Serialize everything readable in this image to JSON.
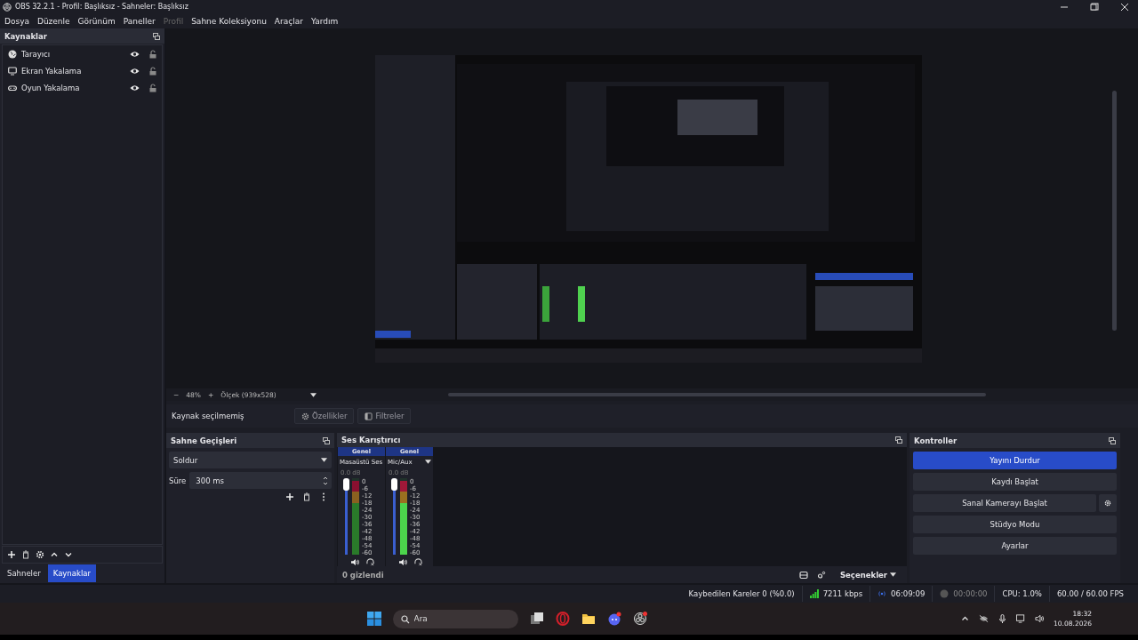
{
  "window": {
    "title": "OBS 32.2.1 - Profil: Başlıksız - Sahneler: Başlıksız"
  },
  "menu": [
    {
      "label": "Dosya",
      "disabled": false
    },
    {
      "label": "Düzenle",
      "disabled": false
    },
    {
      "label": "Görünüm",
      "disabled": false
    },
    {
      "label": "Paneller",
      "disabled": false
    },
    {
      "label": "Profil",
      "disabled": true
    },
    {
      "label": "Sahne Koleksiyonu",
      "disabled": false
    },
    {
      "label": "Araçlar",
      "disabled": false
    },
    {
      "label": "Yardım",
      "disabled": false
    }
  ],
  "sources": {
    "title": "Kaynaklar",
    "items": [
      {
        "name": "Tarayıcı",
        "kind": "browser"
      },
      {
        "name": "Ekran Yakalama",
        "kind": "display"
      },
      {
        "name": "Oyun Yakalama",
        "kind": "game"
      }
    ]
  },
  "dock_tabs": [
    {
      "label": "Sahneler",
      "selected": false
    },
    {
      "label": "Kaynaklar",
      "selected": true
    }
  ],
  "preview": {
    "kind": "picture",
    "zoom_out": "−",
    "zoom": "48%",
    "zoom_in": "+",
    "scale": "Ölçek (939x528)"
  },
  "source_bar": {
    "label": "Kaynak seçilmemiş",
    "buttons": [
      "Özellikler",
      "Filtreler"
    ]
  },
  "transitions": {
    "title": "Sahne Geçişleri",
    "transition": "Soldur",
    "duration_label": "Süre",
    "duration": "300 ms"
  },
  "mixer": {
    "title": "Ses Karıştırıcı",
    "channels": [
      {
        "tag": "Genel",
        "name": "Masaüstü Ses",
        "db": "0.0 dB",
        "fader": {
          "level": 1
        },
        "meter": {
          "level": 0.97
        },
        "active": false,
        "scale": [
          "0",
          "-6",
          "-12",
          "-18",
          "-24",
          "-30",
          "-36",
          "-42",
          "-48",
          "-54",
          "-60"
        ]
      },
      {
        "tag": "Genel",
        "name": "Mic/Aux",
        "db": "0.0 dB",
        "fader": {
          "level": 1
        },
        "meter": {
          "level": 0.97
        },
        "active": true,
        "scale": [
          "0",
          "-6",
          "-12",
          "-18",
          "-24",
          "-30",
          "-36",
          "-42",
          "-48",
          "-54",
          "-60"
        ]
      }
    ],
    "hidden": "0 gizlendi",
    "options": "Seçenekler"
  },
  "controls": {
    "title": "Kontroller",
    "buttons": [
      {
        "label": "Yayını Durdur",
        "active": true,
        "settings": false
      },
      {
        "label": "Kaydı Başlat",
        "active": false,
        "settings": false
      },
      {
        "label": "Sanal Kamerayı Başlat",
        "active": false,
        "settings": true
      },
      {
        "label": "Stüdyo Modu",
        "active": false,
        "settings": false
      },
      {
        "label": "Ayarlar",
        "active": false,
        "settings": false
      }
    ]
  },
  "status_bar": {
    "dropped": "Kaybedilen Kareler 0 (%0.0)",
    "bitrate": "7211 kbps",
    "stream_time": "06:09:09",
    "record_time": "00:00:00",
    "cpu": "CPU: 1.0%",
    "fps": "60.00 / 60.00 FPS"
  },
  "taskbar": {
    "search": {
      "placeholder": "Ara"
    },
    "time": "18:32",
    "date": "10.08.2026"
  }
}
